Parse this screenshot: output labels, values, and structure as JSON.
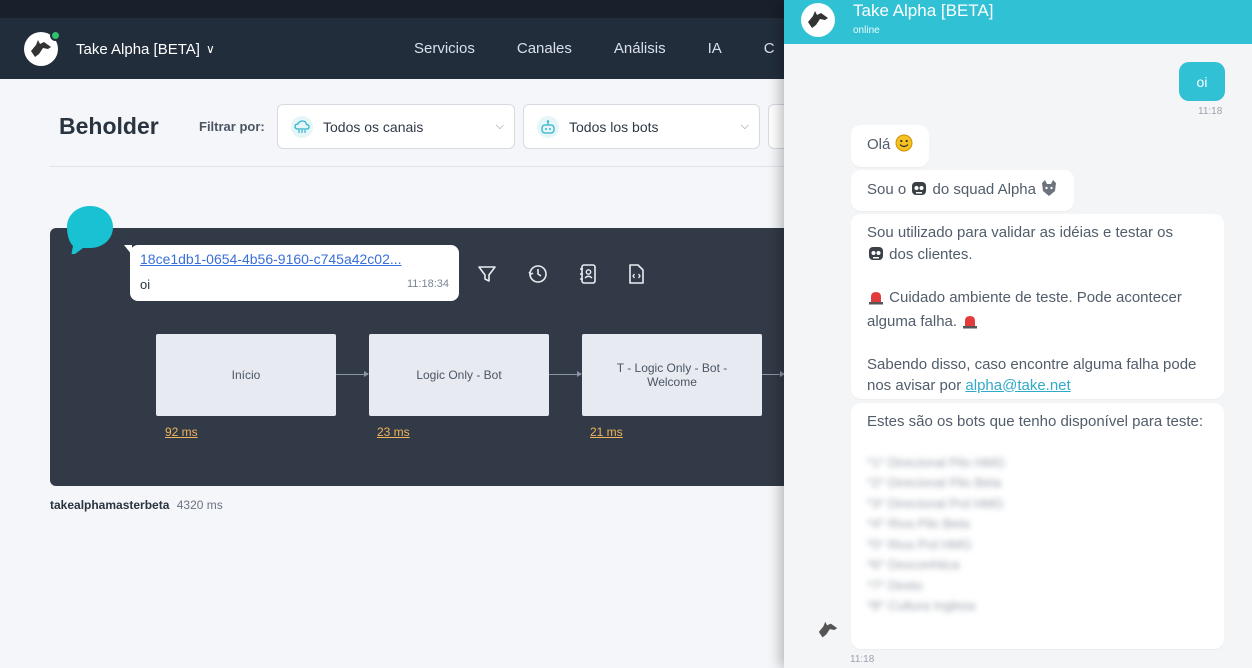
{
  "navbar": {
    "brand": "Take Alpha [BETA]",
    "chevron": "∨",
    "items": [
      "Servicios",
      "Canales",
      "Análisis",
      "IA",
      "C"
    ]
  },
  "page": {
    "title": "Beholder",
    "filter_label": "Filtrar por:",
    "filters": [
      {
        "icon": "cloud-channels-icon",
        "label": "Todos os canais"
      },
      {
        "icon": "bot-icon",
        "label": "Todos los bots"
      }
    ]
  },
  "flow": {
    "message_id": "18ce1db1-0654-4b56-9160-c745a42c02...",
    "message_text": "oi",
    "message_time": "11:18:34",
    "tools": [
      "filter-icon",
      "history-icon",
      "contacts-icon",
      "code-file-icon"
    ],
    "nodes": [
      {
        "label": "Início",
        "time": "92 ms"
      },
      {
        "label": "Logic Only - Bot",
        "time": "23 ms"
      },
      {
        "label": "T - Logic Only - Bot - Welcome",
        "time": "21 ms"
      }
    ],
    "footer_bot": "takealphamasterbeta",
    "footer_time": "4320 ms"
  },
  "chat": {
    "title": "Take Alpha [BETA]",
    "status": "online",
    "user_message": "oi",
    "user_time": "11:18",
    "bot_messages": {
      "greeting": "Olá",
      "intro_a": "Sou o",
      "intro_b": "do squad Alpha",
      "desc_1": "Sou utilizado para validar as idéias e testar os",
      "desc_2": "dos clientes.",
      "warn": "Cuidado ambiente de teste. Pode acontecer alguma falha.",
      "report": "Sabendo disso, caso encontre alguma falha pode nos avisar por",
      "email": "alpha@take.net",
      "bots_intro": "Estes são os bots que tenho disponível para teste:",
      "bots_list": [
        "*1* Direcional Pilo HMG",
        "*2* Direcional Pilo Beta",
        "*3* Direcional Prd HMG",
        "*4* Riva Pilo Beta",
        "*5* Riva Prd HMG",
        "*6* Desconhtica",
        "*7* Direto",
        "*8* Cultura Inglesa"
      ]
    },
    "bot_time": "11:18"
  },
  "colors": {
    "accent": "#31c1d5",
    "navbar": "#222d3c",
    "flow_panel": "#323a47",
    "timing": "#f0b45a"
  }
}
